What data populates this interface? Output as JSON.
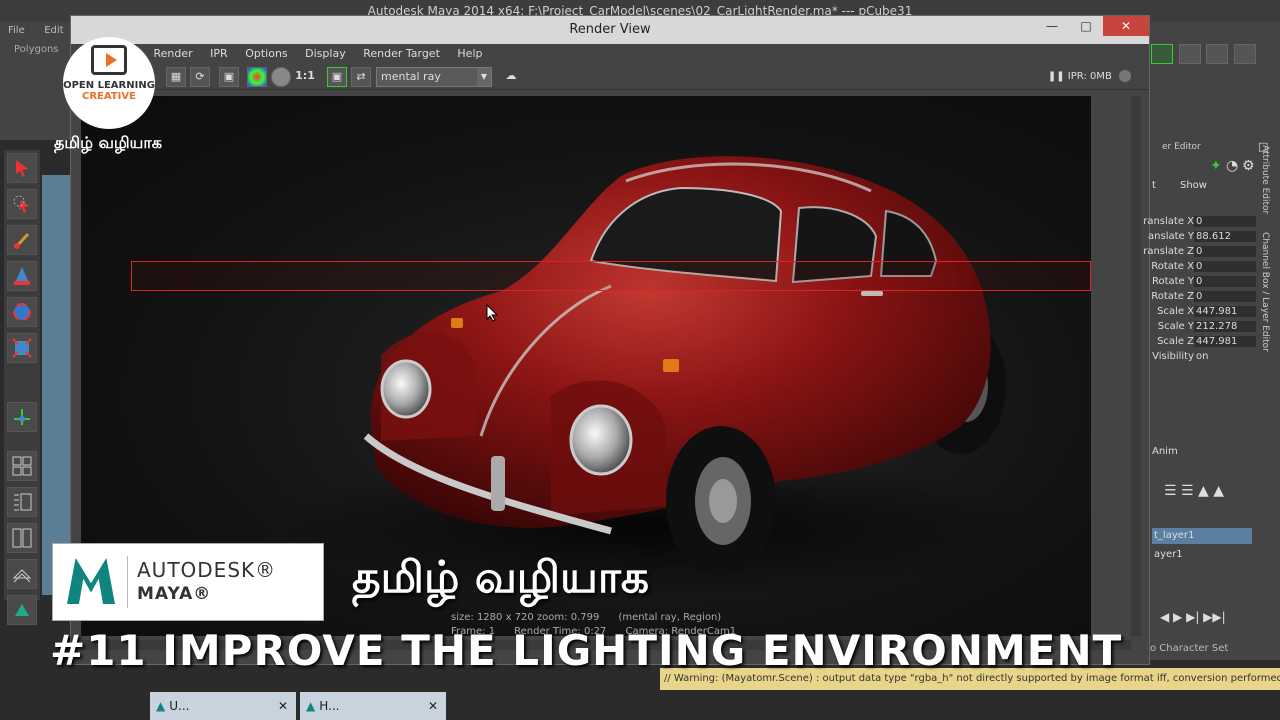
{
  "app": {
    "title": "Autodesk Maya 2014 x64: F:\\Project_CarModel\\scenes\\02_CarLightRender.ma*  ---  pCube31",
    "menu": [
      "File",
      "Edit"
    ],
    "mode_select": "Polygons"
  },
  "render_view": {
    "title": "Render View",
    "menus": [
      "Render",
      "IPR",
      "Options",
      "Display",
      "Render Target",
      "Help"
    ],
    "toolbar": {
      "ratio_label": "1:1",
      "renderer": "mental ray",
      "ipr_status": "IPR: 0MB"
    },
    "info": {
      "size_line": "size: 1280 x 720 zoom: 0.799",
      "renderer_line": "(mental ray, Region)",
      "frame": "Frame: 1",
      "render_time": "Render Time: 0:27",
      "camera": "Camera: RenderCam1"
    }
  },
  "attribute_panel": {
    "header": "er Editor",
    "tabs": [
      "t",
      "Show"
    ],
    "attributes": [
      {
        "label": "ranslate X",
        "value": "0"
      },
      {
        "label": "anslate Y",
        "value": "88.612"
      },
      {
        "label": "ranslate Z",
        "value": "0"
      },
      {
        "label": "Rotate X",
        "value": "0"
      },
      {
        "label": "Rotate Y",
        "value": "0"
      },
      {
        "label": "Rotate Z",
        "value": "0"
      },
      {
        "label": "Scale X",
        "value": "447.981"
      },
      {
        "label": "Scale Y",
        "value": "212.278"
      },
      {
        "label": "Scale Z",
        "value": "447.981"
      },
      {
        "label": "Visibility",
        "value": "on"
      }
    ],
    "side_tabs": [
      "Attribute Editor",
      "Channel Box / Layer Editor"
    ],
    "anim_tab": "Anim",
    "layers": [
      "t_layer1",
      "ayer1"
    ],
    "character_set": "o Character Set"
  },
  "help_line": "// Warning: (Mayatomr.Scene) : output data type \"rgba_h\" not directly supported by image format iff, conversion performed by men",
  "taskbar": [
    {
      "label": "U..."
    },
    {
      "label": "H..."
    }
  ],
  "overlay": {
    "logo_line1": "OPEN LEARNING",
    "logo_line2": "CREATIVE",
    "tamil_small": "தமிழ் வழியாக",
    "badge_autodesk": "AUTODESK®",
    "badge_maya": "MAYA®",
    "tamil_big": "தமிழ் வழியாக",
    "episode_title": "#11 IMPROVE THE LIGHTING ENVIRONMENT"
  },
  "colors": {
    "car_red": "#8b1414",
    "region_border": "#dd2222",
    "maya_teal": "#10847e",
    "logo_orange": "#e8702a",
    "warning_bg": "#e8d58a"
  }
}
